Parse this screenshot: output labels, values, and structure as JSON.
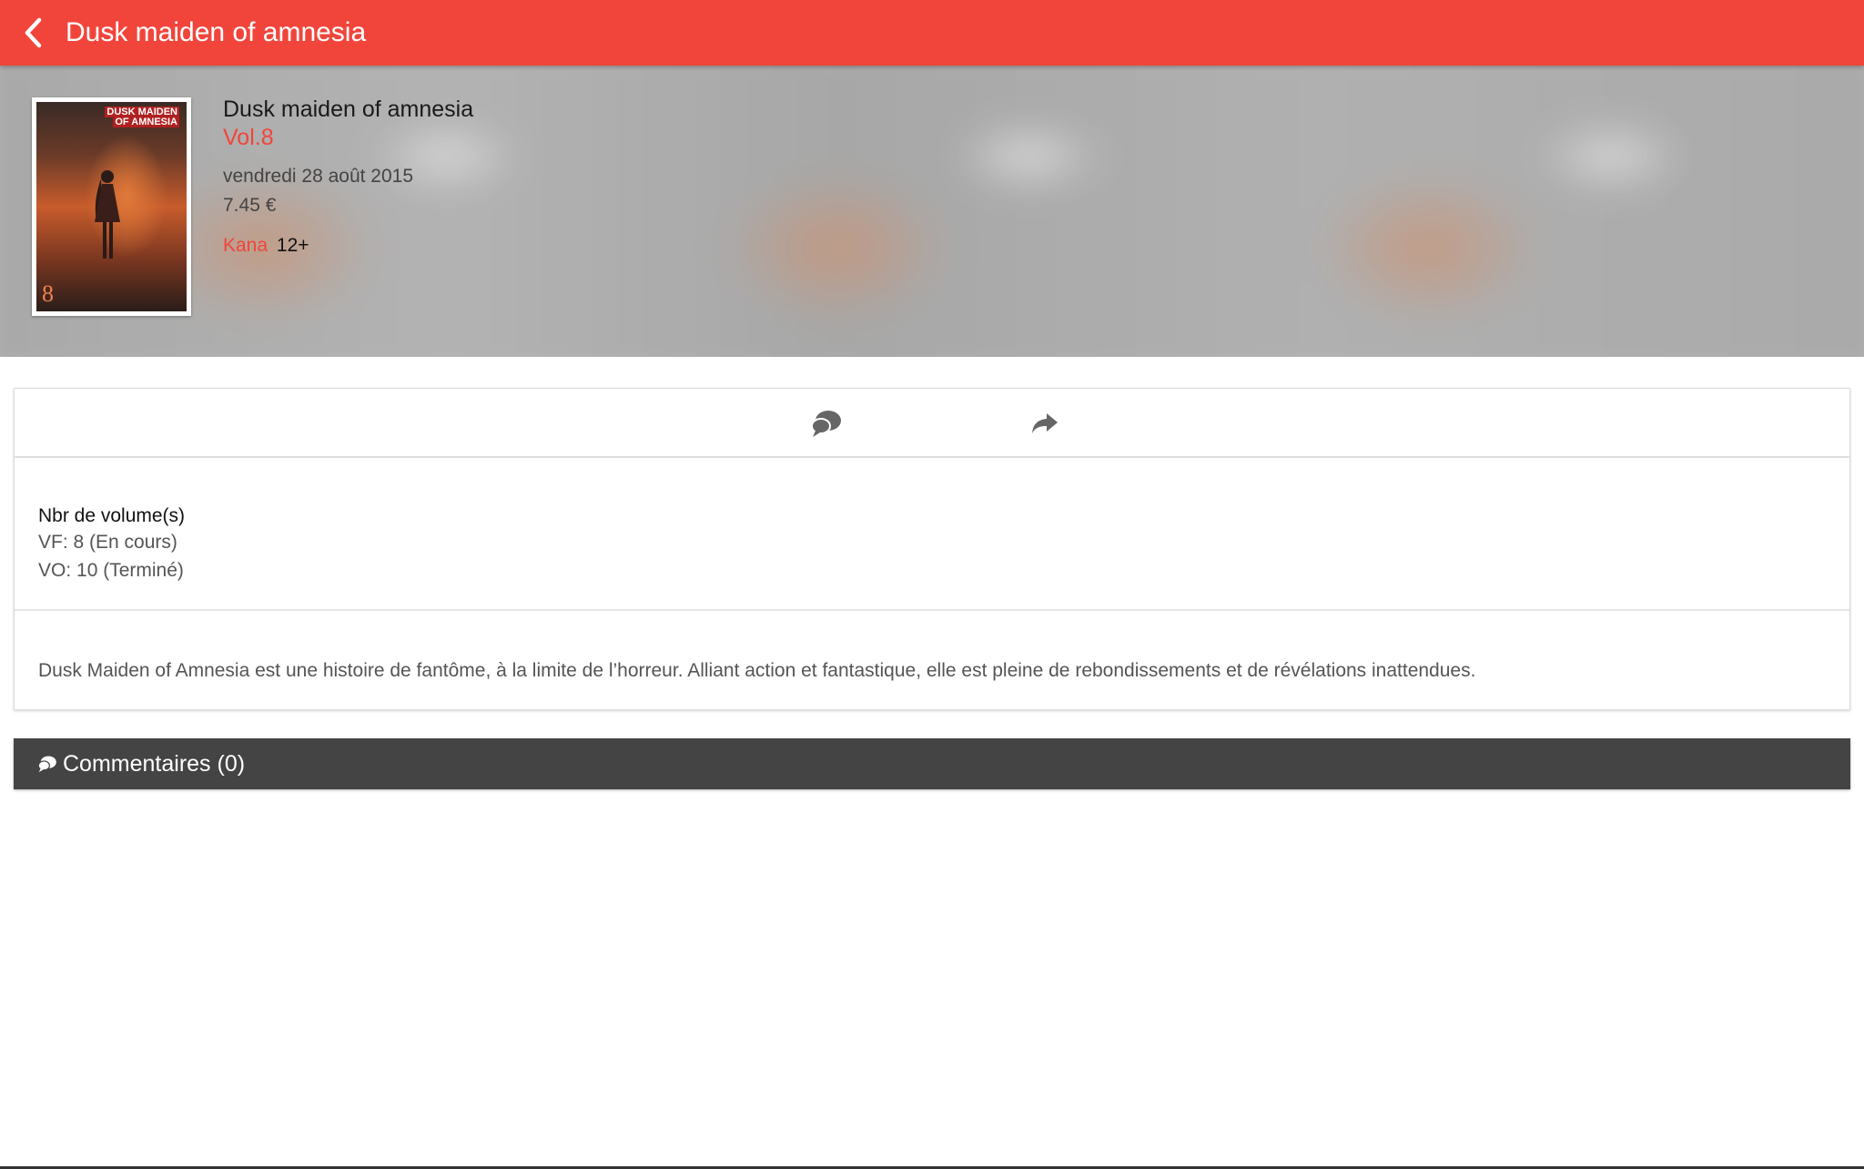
{
  "appbar": {
    "title": "Dusk maiden of amnesia",
    "color": "#f1453b"
  },
  "book": {
    "title": "Dusk maiden of amnesia",
    "volume": "Vol.8",
    "release_date": "vendredi 28 août 2015",
    "price": "7.45 €",
    "publisher": "Kana",
    "age_rating": "12+",
    "cover": {
      "logo_line1": "DUSK MAIDEN",
      "logo_line2": "OF AMNESIA",
      "volume_number": "8"
    }
  },
  "actions": {
    "comment_icon": "chat-bubbles-icon",
    "share_icon": "share-arrow-icon"
  },
  "volumes": {
    "heading": "Nbr de volume(s)",
    "vf": "VF: 8 (En cours)",
    "vo": "VO: 10 (Terminé)"
  },
  "description": "Dusk Maiden of Amnesia est une histoire de fantôme, à la limite de l’horreur. Alliant action et fantastique, elle est pleine de rebondissements et de révélations inattendues.",
  "comments": {
    "label": "Commentaires (0)"
  }
}
